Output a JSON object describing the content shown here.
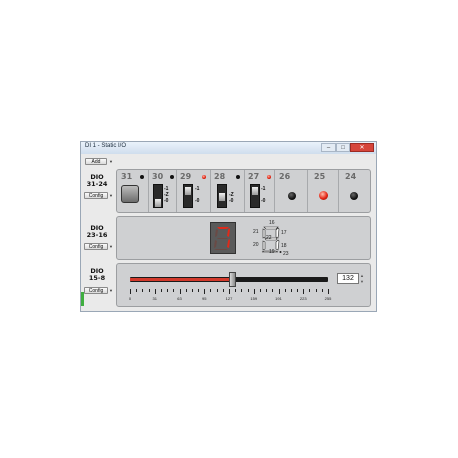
{
  "window": {
    "title": "DI 1 - Static I/O",
    "controls": [
      "–",
      "□",
      "✕"
    ]
  },
  "toolbar": {
    "add_label": "Add"
  },
  "groups": [
    {
      "label_line1": "DIO",
      "label_line2": "31-24",
      "config_label": "Config"
    },
    {
      "label_line1": "DIO",
      "label_line2": "23-16",
      "config_label": "Config"
    },
    {
      "label_line1": "DIO",
      "label_line2": "15-8",
      "config_label": "Config"
    }
  ],
  "dio_31_24": {
    "bits": [
      "31",
      "30",
      "29",
      "28",
      "27",
      "26",
      "25",
      "24"
    ],
    "switch_labels": [
      "-1",
      "-Z",
      "-0"
    ],
    "led_states": [
      "off",
      "off",
      "on",
      "off",
      "on",
      "off",
      "on",
      "off"
    ]
  },
  "dio_23_16": {
    "seven_segment_digit": "7",
    "segment_labels": [
      "16",
      "17",
      "18",
      "19",
      "20",
      "21",
      "22",
      "23"
    ]
  },
  "dio_15_8": {
    "slider_value": "132",
    "slider_level": 132,
    "slider_max": 255,
    "tick_labels": [
      "0",
      "31",
      "63",
      "95",
      "127",
      "159",
      "191",
      "223",
      "255"
    ],
    "spin_up": "▲",
    "spin_down": "▼"
  }
}
